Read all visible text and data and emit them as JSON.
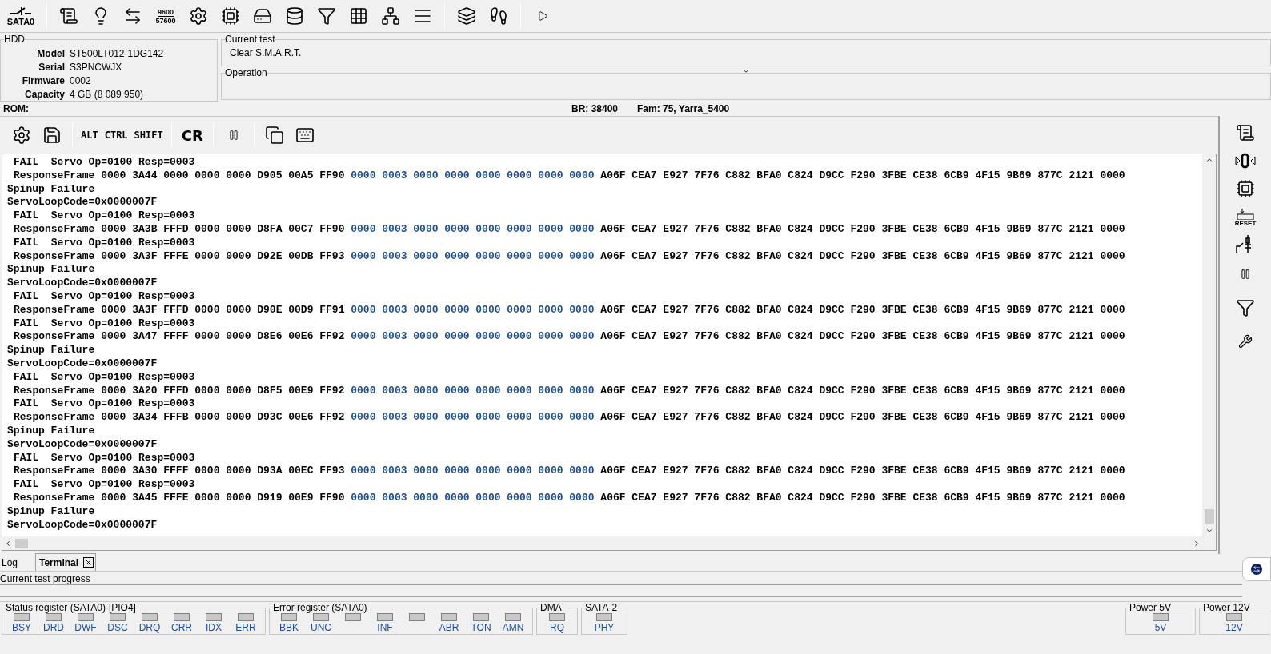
{
  "toolbar": {
    "port_label": "SATA0",
    "baud_icon": [
      "9600",
      "57600"
    ]
  },
  "hdd": {
    "title": "HDD",
    "fields": [
      {
        "label": "Model",
        "value": "ST500LT012-1DG142"
      },
      {
        "label": "Serial",
        "value": "S3PNCWJX"
      },
      {
        "label": "Firmware",
        "value": "0002"
      },
      {
        "label": "Capacity",
        "value": "4 GB (8 089 950)"
      }
    ]
  },
  "current_test": {
    "title": "Current test",
    "value": "Clear S.M.A.R.T."
  },
  "operation": {
    "title": "Operation"
  },
  "info_bar": {
    "rom": "ROM:",
    "br": "BR: 38400",
    "fam": "Fam: 75, Yarra_5400"
  },
  "terminal_toolbar": {
    "keys": [
      "ALT",
      "CTRL",
      "SHIFT"
    ],
    "cr": "CR"
  },
  "terminal": {
    "lines": [
      {
        "kind": "sub",
        "text": "FAIL  Servo Op=0100 Resp=0003"
      },
      {
        "kind": "frame",
        "segments": [
          {
            "text": "ResponseFrame 0000 3A44 0000 0000 0000 D905 00A5 FF90",
            "color": "#000000"
          },
          {
            "text": "0000 0003 0000 0000 0000 0000 0000 0000",
            "color": "#1f4e8c"
          },
          {
            "text": "A06F CEA7 E927 7F76 C882 BFA0 C824 D9CC F290 3FBE CE38 6CB9 4F15 9B69 877C 2121 0000",
            "color": "#000000"
          }
        ]
      },
      {
        "kind": "plain",
        "text": "Spinup Failure"
      },
      {
        "kind": "plain",
        "text": "ServoLoopCode=0x0000007F"
      },
      {
        "kind": "sub",
        "text": "FAIL  Servo Op=0100 Resp=0003"
      },
      {
        "kind": "frame",
        "segments": [
          {
            "text": "ResponseFrame 0000 3A3B FFFD 0000 0000 D8FA 00C7 FF90",
            "color": "#000000"
          },
          {
            "text": "0000 0003 0000 0000 0000 0000 0000 0000",
            "color": "#1f4e8c"
          },
          {
            "text": "A06F CEA7 E927 7F76 C882 BFA0 C824 D9CC F290 3FBE CE38 6CB9 4F15 9B69 877C 2121 0000",
            "color": "#000000"
          }
        ]
      },
      {
        "kind": "sub",
        "text": "FAIL  Servo Op=0100 Resp=0003"
      },
      {
        "kind": "frame",
        "segments": [
          {
            "text": "ResponseFrame 0000 3A3F FFFE 0000 0000 D92E 00DB FF93",
            "color": "#000000"
          },
          {
            "text": "0000 0003 0000 0000 0000 0000 0000 0000",
            "color": "#1f4e8c"
          },
          {
            "text": "A06F CEA7 E927 7F76 C882 BFA0 C824 D9CC F290 3FBE CE38 6CB9 4F15 9B69 877C 2121 0000",
            "color": "#000000"
          }
        ]
      },
      {
        "kind": "plain",
        "text": "Spinup Failure"
      },
      {
        "kind": "plain",
        "text": "ServoLoopCode=0x0000007F"
      },
      {
        "kind": "sub",
        "text": "FAIL  Servo Op=0100 Resp=0003"
      },
      {
        "kind": "frame",
        "segments": [
          {
            "text": "ResponseFrame 0000 3A3F FFFD 0000 0000 D90E 00D9 FF91",
            "color": "#000000"
          },
          {
            "text": "0000 0003 0000 0000 0000 0000 0000 0000",
            "color": "#1f4e8c"
          },
          {
            "text": "A06F CEA7 E927 7F76 C882 BFA0 C824 D9CC F290 3FBE CE38 6CB9 4F15 9B69 877C 2121 0000",
            "color": "#000000"
          }
        ]
      },
      {
        "kind": "sub",
        "text": "FAIL  Servo Op=0100 Resp=0003"
      },
      {
        "kind": "frame",
        "segments": [
          {
            "text": "ResponseFrame 0000 3A47 FFFF 0000 0000 D8E6 00E6 FF92",
            "color": "#000000"
          },
          {
            "text": "0000 0003 0000 0000 0000 0000 0000 0000",
            "color": "#1f4e8c"
          },
          {
            "text": "A06F CEA7 E927 7F76 C882 BFA0 C824 D9CC F290 3FBE CE38 6CB9 4F15 9B69 877C 2121 0000",
            "color": "#000000"
          }
        ]
      },
      {
        "kind": "plain",
        "text": "Spinup Failure"
      },
      {
        "kind": "plain",
        "text": "ServoLoopCode=0x0000007F"
      },
      {
        "kind": "sub",
        "text": "FAIL  Servo Op=0100 Resp=0003"
      },
      {
        "kind": "frame",
        "segments": [
          {
            "text": "ResponseFrame 0000 3A20 FFFD 0000 0000 D8F5 00E9 FF92",
            "color": "#000000"
          },
          {
            "text": "0000 0003 0000 0000 0000 0000 0000 0000",
            "color": "#1f4e8c"
          },
          {
            "text": "A06F CEA7 E927 7F76 C882 BFA0 C824 D9CC F290 3FBE CE38 6CB9 4F15 9B69 877C 2121 0000",
            "color": "#000000"
          }
        ]
      },
      {
        "kind": "sub",
        "text": "FAIL  Servo Op=0100 Resp=0003"
      },
      {
        "kind": "frame",
        "segments": [
          {
            "text": "ResponseFrame 0000 3A34 FFFB 0000 0000 D93C 00E6 FF92",
            "color": "#000000"
          },
          {
            "text": "0000 0003 0000 0000 0000 0000 0000 0000",
            "color": "#1f4e8c"
          },
          {
            "text": "A06F CEA7 E927 7F76 C882 BFA0 C824 D9CC F290 3FBE CE38 6CB9 4F15 9B69 877C 2121 0000",
            "color": "#000000"
          }
        ]
      },
      {
        "kind": "plain",
        "text": "Spinup Failure"
      },
      {
        "kind": "plain",
        "text": "ServoLoopCode=0x0000007F"
      },
      {
        "kind": "sub",
        "text": "FAIL  Servo Op=0100 Resp=0003"
      },
      {
        "kind": "frame",
        "segments": [
          {
            "text": "ResponseFrame 0000 3A30 FFFF 0000 0000 D93A 00EC FF93",
            "color": "#000000"
          },
          {
            "text": "0000 0003 0000 0000 0000 0000 0000 0000",
            "color": "#1f4e8c"
          },
          {
            "text": "A06F CEA7 E927 7F76 C882 BFA0 C824 D9CC F290 3FBE CE38 6CB9 4F15 9B69 877C 2121 0000",
            "color": "#000000"
          }
        ]
      },
      {
        "kind": "sub",
        "text": "FAIL  Servo Op=0100 Resp=0003"
      },
      {
        "kind": "frame",
        "segments": [
          {
            "text": "ResponseFrame 0000 3A45 FFFE 0000 0000 D919 00E9 FF90",
            "color": "#000000"
          },
          {
            "text": "0000 0003 0000 0000 0000 0000 0000 0000",
            "color": "#1f4e8c"
          },
          {
            "text": "A06F CEA7 E927 7F76 C882 BFA0 C824 D9CC F290 3FBE CE38 6CB9 4F15 9B69 877C 2121 0000",
            "color": "#000000"
          }
        ]
      },
      {
        "kind": "plain",
        "text": "Spinup Failure"
      },
      {
        "kind": "plain",
        "text": "ServoLoopCode=0x0000007F"
      }
    ]
  },
  "side_toolbar": {
    "reset_label": "RESET"
  },
  "tabs": [
    {
      "label": "Log",
      "selected": false,
      "closable": false
    },
    {
      "label": "Terminal",
      "selected": true,
      "closable": true
    }
  ],
  "progress": {
    "title": "Current test progress"
  },
  "registers": [
    {
      "title": "Status register (SATA0)-[PIO4]",
      "leds": [
        {
          "label": "BSY",
          "on": false
        },
        {
          "label": "DRD",
          "on": false
        },
        {
          "label": "DWF",
          "on": false
        },
        {
          "label": "DSC",
          "on": false
        },
        {
          "label": "DRQ",
          "on": false
        },
        {
          "label": "CRR",
          "on": false
        },
        {
          "label": "IDX",
          "on": false
        },
        {
          "label": "ERR",
          "on": false
        }
      ]
    },
    {
      "title": "Error register (SATA0)",
      "leds": [
        {
          "label": "BBK",
          "on": false
        },
        {
          "label": "UNC",
          "on": false
        },
        {
          "on": false
        },
        {
          "label": "INF",
          "on": false
        },
        {
          "on": false
        },
        {
          "label": "ABR",
          "on": false
        },
        {
          "label": "TON",
          "on": false
        },
        {
          "label": "AMN",
          "on": false
        }
      ]
    },
    {
      "title": "DMA",
      "leds": [
        {
          "label": "RQ",
          "on": false
        }
      ]
    },
    {
      "title": "SATA-2",
      "leds": [
        {
          "label": "PHY",
          "on": false
        }
      ]
    }
  ],
  "power": [
    {
      "title": "Power 5V",
      "leds": [
        {
          "label": "5V",
          "on": false
        }
      ]
    },
    {
      "title": "Power 12V",
      "leds": [
        {
          "label": "12V",
          "on": false
        }
      ]
    }
  ]
}
